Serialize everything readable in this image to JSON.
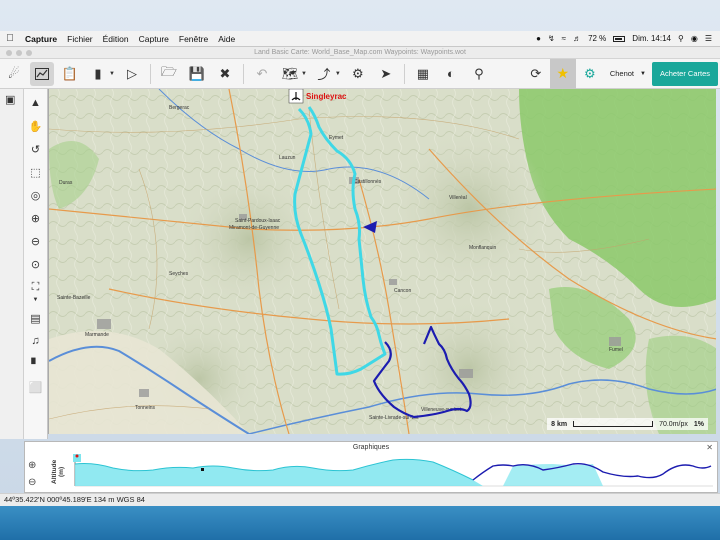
{
  "menubar": {
    "items": [
      "Capture",
      "Fichier",
      "Édition",
      "Capture",
      "Fenêtre",
      "Aide"
    ],
    "battery": "72 %",
    "clock": "Dim. 14:14"
  },
  "window": {
    "title": "Land Basic Carte: World_Base_Map.com Waypoints: Waypoints.wot"
  },
  "toolbar": {
    "user": "Chenot",
    "buy_label": "Acheter Cartes"
  },
  "map": {
    "waypoint_label": "Singleyrac",
    "towns": [
      "Castillonnès",
      "Saint-Pardoux-Isaac",
      "Miramont-de-Guyenne",
      "Villeréal",
      "Marmande",
      "Cancon",
      "Monflanquin",
      "Sainte-Bazeille",
      "Villeneuve-sur-Lot",
      "Sainte-Livrade-sur-Lot",
      "Fumel",
      "Tonneins",
      "Duras",
      "Eymet",
      "Bergerac",
      "Lauzun",
      "Seyches"
    ],
    "scale_label": "8 km",
    "resolution": "70.0m/px",
    "zoom": "1%"
  },
  "graph": {
    "title": "Graphiques",
    "ylabel": "Altitude (m)"
  },
  "statusbar": {
    "coords": "44º35.422'N 000º45.189'E  134 m  WGS 84"
  },
  "colors": {
    "route_cyan": "#3fd8e6",
    "route_blue": "#1c1cb0",
    "accent_teal": "#19a79a"
  }
}
